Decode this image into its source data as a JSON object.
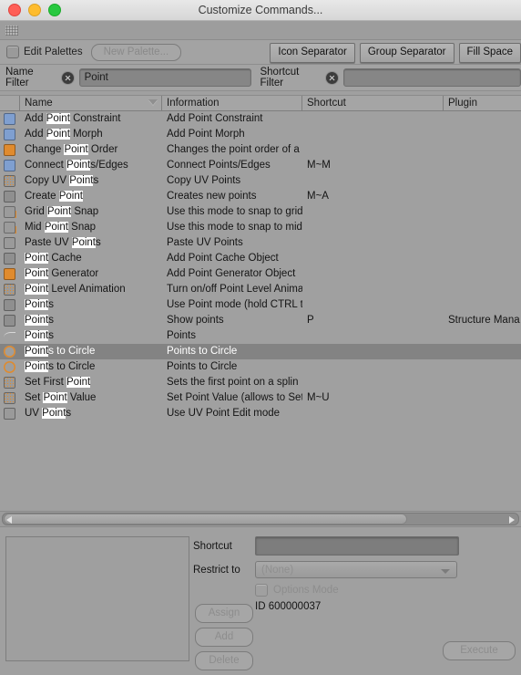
{
  "window": {
    "title": "Customize Commands...",
    "traffic_lights": [
      "close-button",
      "minimize-button",
      "maximize-button"
    ]
  },
  "palette_bar": {
    "edit_palettes_label": "Edit Palettes",
    "edit_palettes_checked": false,
    "new_palette_label": "New Palette...",
    "buttons": [
      "Icon Separator",
      "Group Separator",
      "Fill Space"
    ]
  },
  "filters": {
    "name_label": "Name Filter",
    "name_value": "Point",
    "shortcut_label": "Shortcut Filter",
    "shortcut_value": ""
  },
  "table": {
    "columns": [
      "",
      "Name",
      "Information",
      "Shortcut",
      "Plugin"
    ],
    "sorted_column": "Name",
    "rows": [
      {
        "icon": "add-point-constraint-icon",
        "name_pre": "Add ",
        "name_hit": "Point",
        "name_post": " Constraint",
        "information": "Add Point Constraint",
        "shortcut": "",
        "plugin": "",
        "selected": false
      },
      {
        "icon": "add-point-morph-icon",
        "name_pre": "Add ",
        "name_hit": "Point",
        "name_post": " Morph",
        "information": "Add Point Morph",
        "shortcut": "",
        "plugin": "",
        "selected": false
      },
      {
        "icon": "change-point-order-icon",
        "name_pre": "Change ",
        "name_hit": "Point",
        "name_post": " Order",
        "information": "Changes the point order of a",
        "shortcut": "",
        "plugin": "",
        "selected": false
      },
      {
        "icon": "connect-points-edges-icon",
        "name_pre": "Connect ",
        "name_hit": "Point",
        "name_post": "s/Edges",
        "information": "Connect Points/Edges",
        "shortcut": "M~M",
        "plugin": "",
        "selected": false
      },
      {
        "icon": "copy-uv-points-icon",
        "name_pre": "Copy UV ",
        "name_hit": "Point",
        "name_post": "s",
        "information": "Copy UV Points",
        "shortcut": "",
        "plugin": "",
        "selected": false
      },
      {
        "icon": "create-point-icon",
        "name_pre": "Create ",
        "name_hit": "Point",
        "name_post": "",
        "information": "Creates new points",
        "shortcut": "M~A",
        "plugin": "",
        "selected": false
      },
      {
        "icon": "grid-point-snap-icon",
        "name_pre": "Grid ",
        "name_hit": "Point",
        "name_post": " Snap",
        "information": "Use this mode to snap to grid",
        "shortcut": "",
        "plugin": "",
        "selected": false
      },
      {
        "icon": "mid-point-snap-icon",
        "name_pre": "Mid ",
        "name_hit": "Point",
        "name_post": " Snap",
        "information": "Use this mode to snap to mid",
        "shortcut": "",
        "plugin": "",
        "selected": false
      },
      {
        "icon": "paste-uv-points-icon",
        "name_pre": "Paste UV ",
        "name_hit": "Point",
        "name_post": "s",
        "information": "Paste UV Points",
        "shortcut": "",
        "plugin": "",
        "selected": false
      },
      {
        "icon": "point-cache-icon",
        "name_pre": "",
        "name_hit": "Point",
        "name_post": " Cache",
        "information": "Add Point Cache Object",
        "shortcut": "",
        "plugin": "",
        "selected": false
      },
      {
        "icon": "point-generator-icon",
        "name_pre": "",
        "name_hit": "Point",
        "name_post": " Generator",
        "information": "Add Point Generator Object",
        "shortcut": "",
        "plugin": "",
        "selected": false
      },
      {
        "icon": "point-level-animation-icon",
        "name_pre": "",
        "name_hit": "Point",
        "name_post": " Level Animation",
        "information": "Turn on/off Point Level Anima",
        "shortcut": "",
        "plugin": "",
        "selected": false
      },
      {
        "icon": "points-mode-icon",
        "name_pre": "",
        "name_hit": "Point",
        "name_post": "s",
        "information": "Use Point mode (hold CTRL t",
        "shortcut": "",
        "plugin": "",
        "selected": false
      },
      {
        "icon": "show-points-icon",
        "name_pre": "",
        "name_hit": "Point",
        "name_post": "s",
        "information": "Show points",
        "shortcut": "P",
        "plugin": "Structure Mana",
        "selected": false
      },
      {
        "icon": "points-spline-icon",
        "name_pre": "",
        "name_hit": "Point",
        "name_post": "s",
        "information": "Points",
        "shortcut": "",
        "plugin": "",
        "selected": false
      },
      {
        "icon": "points-to-circle-icon",
        "name_pre": "",
        "name_hit": "Point",
        "name_post": "s to Circle",
        "information": "Points to Circle",
        "shortcut": "",
        "plugin": "",
        "selected": true
      },
      {
        "icon": "points-to-circle-icon",
        "name_pre": "",
        "name_hit": "Point",
        "name_post": "s to Circle",
        "information": "Points to Circle",
        "shortcut": "",
        "plugin": "",
        "selected": false
      },
      {
        "icon": "set-first-point-icon",
        "name_pre": "Set First ",
        "name_hit": "Point",
        "name_post": "",
        "information": "Sets the first point on a splin",
        "shortcut": "",
        "plugin": "",
        "selected": false
      },
      {
        "icon": "set-point-value-icon",
        "name_pre": "Set ",
        "name_hit": "Point",
        "name_post": " Value",
        "information": "Set Point Value (allows to Set",
        "shortcut": "M~U",
        "plugin": "",
        "selected": false
      },
      {
        "icon": "uv-points-icon",
        "name_pre": "UV ",
        "name_hit": "Point",
        "name_post": "s",
        "information": "Use UV Point Edit mode",
        "shortcut": "",
        "plugin": "",
        "selected": false
      }
    ]
  },
  "details": {
    "shortcut_label": "Shortcut",
    "shortcut_value": "",
    "restrict_label": "Restrict to",
    "restrict_value": "(None)",
    "options_mode_label": "Options Mode",
    "options_mode_checked": false,
    "id_text": "ID 600000037",
    "assign_label": "Assign",
    "add_label": "Add",
    "delete_label": "Delete",
    "execute_label": "Execute"
  },
  "icon_colors": {
    "blue": "#7f9fd0",
    "orange": "#e08b2e",
    "gray": "#8c8c8c",
    "dark": "#5a5a5a"
  }
}
